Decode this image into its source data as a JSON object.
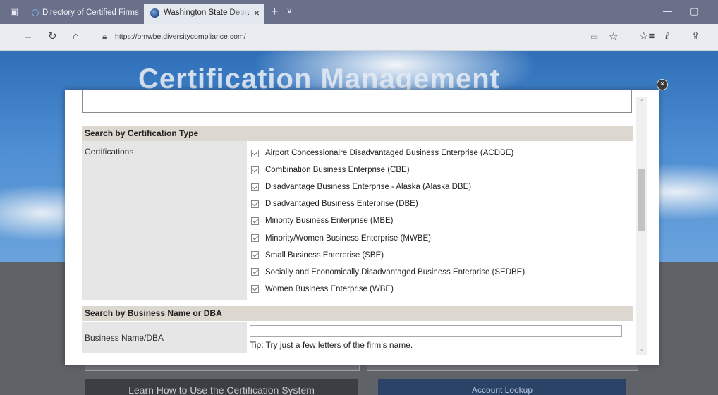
{
  "browser": {
    "tabs": [
      {
        "label": "Directory of Certified Firms"
      },
      {
        "label": "Washington State Depa"
      }
    ],
    "url": "https://omwbe.diversitycompliance.com/",
    "icons": {
      "tab_back": "tab-back-icon",
      "new_tab": "+",
      "tab_menu": "chevron-down-icon",
      "tab_close": "×",
      "minimize": "—",
      "maximize": "▢",
      "back": "→",
      "refresh": "↻",
      "home": "⌂",
      "lock": "🔒︎",
      "reading_view": "▭",
      "star": "☆",
      "favorites": "☆≡",
      "pen": "ℓ",
      "share": "⇪"
    }
  },
  "banner": {
    "title": "Certification Management"
  },
  "background_buttons": {
    "learn": "Learn How to Use the Certification System",
    "account": "Account Lookup"
  },
  "modal": {
    "close_symbol": "×",
    "certification_section": {
      "header": "Search by Certification Type",
      "label": "Certifications",
      "items": [
        {
          "label": "Airport Concessionaire Disadvantaged Business Enterprise (ACDBE)",
          "checked": true
        },
        {
          "label": "Combination Business Enterprise (CBE)",
          "checked": true
        },
        {
          "label": "Disadvantage Business Enterprise - Alaska (Alaska DBE)",
          "checked": true
        },
        {
          "label": "Disadvantaged Business Enterprise (DBE)",
          "checked": true
        },
        {
          "label": "Minority Business Enterprise (MBE)",
          "checked": true
        },
        {
          "label": "Minority/Women Business Enterprise (MWBE)",
          "checked": true
        },
        {
          "label": "Small Business Enterprise (SBE)",
          "checked": true
        },
        {
          "label": "Socially and Economically Disadvantaged Business Enterprise (SEDBE)",
          "checked": true
        },
        {
          "label": "Women Business Enterprise (WBE)",
          "checked": true
        }
      ]
    },
    "name_section": {
      "header": "Search by Business Name or DBA",
      "label": "Business Name/DBA",
      "input_value": "",
      "tip": "Tip: Try just a few letters of the firm's name."
    },
    "scrollbar": {
      "up": "⌃",
      "down": "⌄",
      "position_fraction": 0.27
    }
  }
}
